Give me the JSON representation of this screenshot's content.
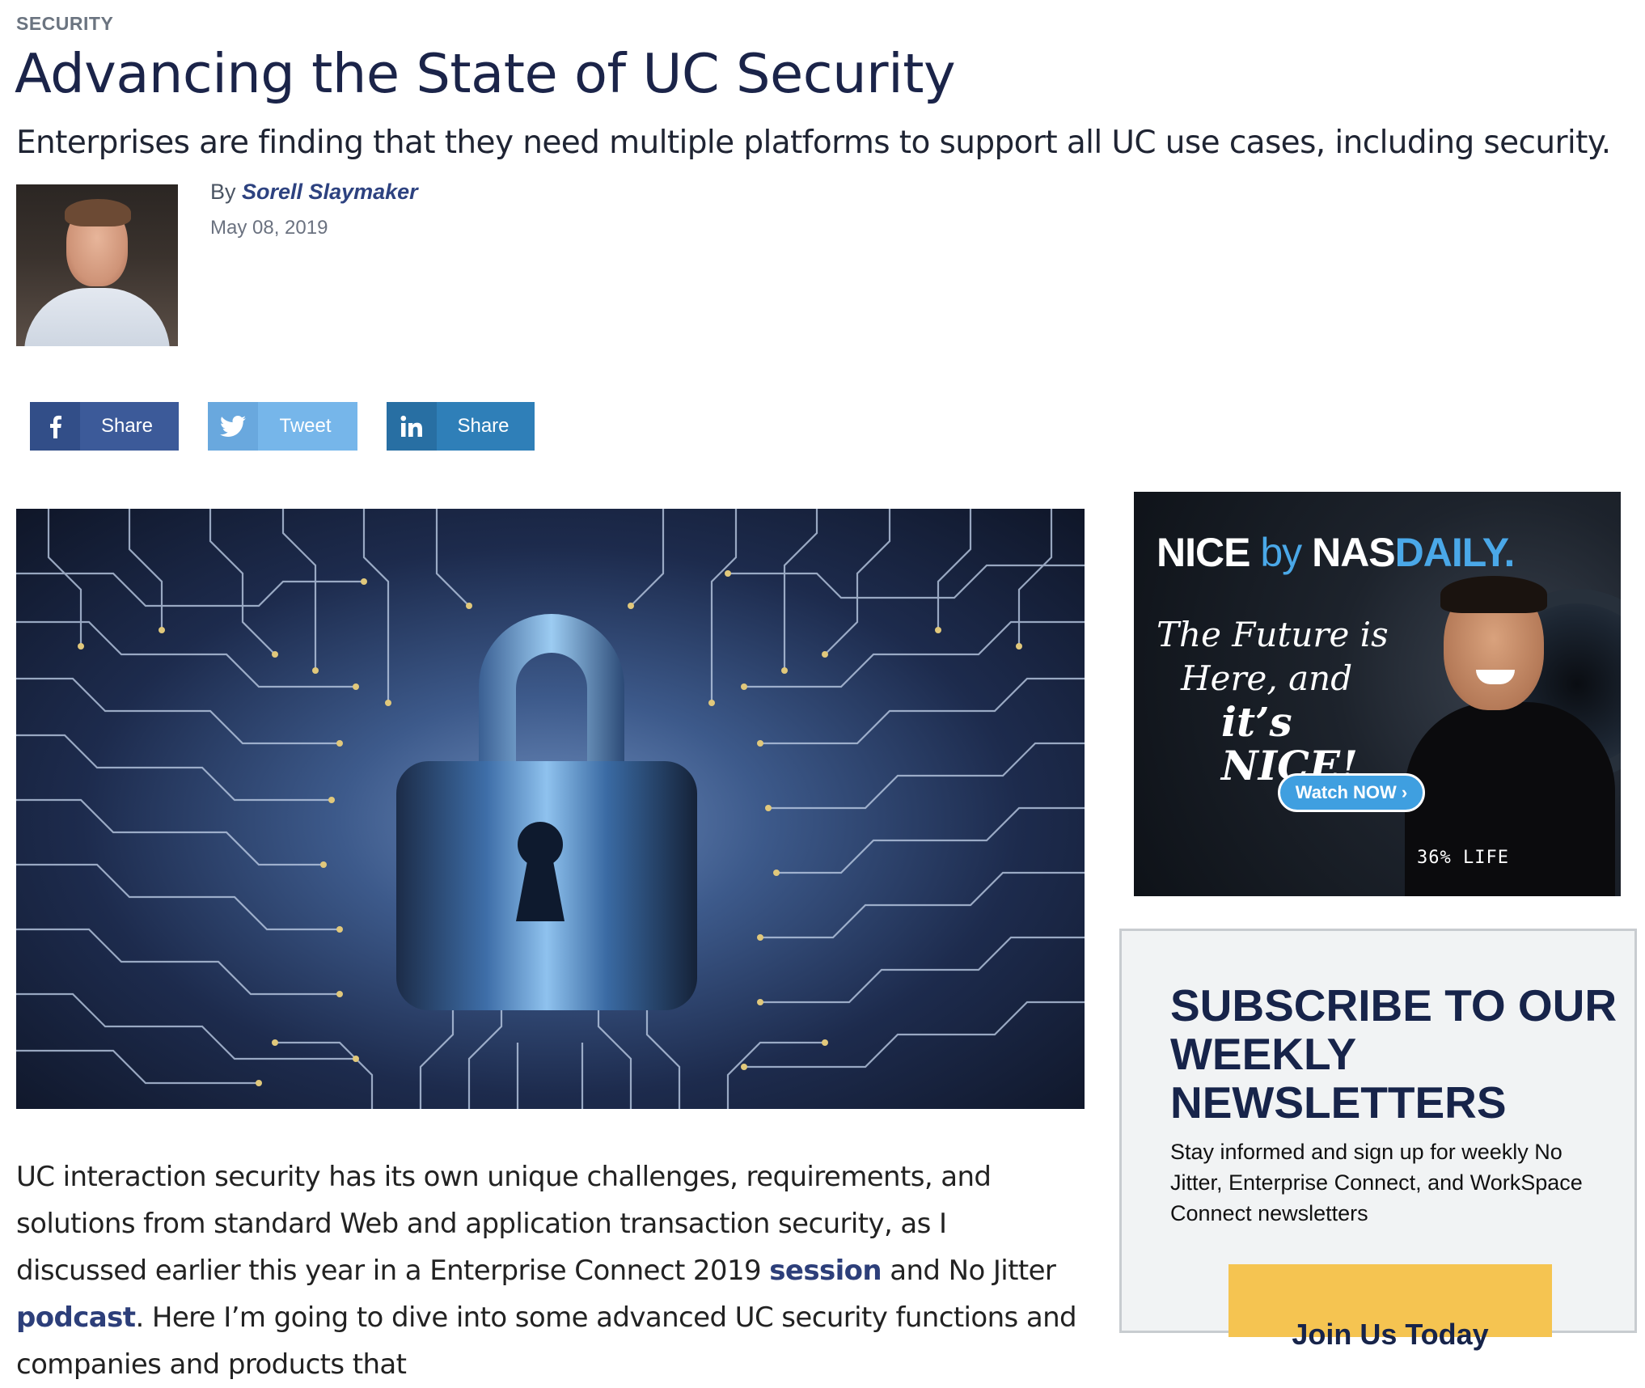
{
  "article": {
    "category": "SECURITY",
    "title": "Advancing the State of UC Security",
    "subtitle": "Enterprises are finding that they need multiple platforms to support all UC use cases, including security.",
    "byline_prefix": "By",
    "author": "Sorell Slaymaker",
    "date": "May 08, 2019",
    "body": {
      "p1_a": "UC interaction security has its own unique challenges, requirements, and solutions from standard Web and application transaction security, as I discussed earlier this year in a Enterprise Connect 2019 ",
      "link_session": "session",
      "p1_b": " and No Jitter ",
      "link_podcast": "podcast",
      "p1_c": ". Here I’m going to dive into some advanced UC security functions and companies and products that"
    }
  },
  "share": {
    "facebook_label": "Share",
    "twitter_label": "Tweet",
    "linkedin_label": "Share"
  },
  "ad": {
    "brand_nice": "NICE",
    "brand_by": "by",
    "brand_nas": "NAS",
    "brand_daily": "DAILY.",
    "tagline_1": "The Future is",
    "tagline_2": "Here, and",
    "tagline_3": "it’s NICE!",
    "cta": "Watch NOW ›",
    "shirt_text": "36%  LIFE"
  },
  "newsletter": {
    "title": "SUBSCRIBE TO OUR WEEKLY NEWSLETTERS",
    "description": "Stay informed and sign up for weekly No Jitter, Enterprise Connect, and WorkSpace Connect newsletters",
    "button": "Join Us Today"
  },
  "colors": {
    "title_navy": "#1b2449",
    "link_blue": "#2d3f7a",
    "facebook": "#3c5a99",
    "twitter": "#76b6ea",
    "linkedin": "#2f7fb8",
    "newsletter_button": "#f5c451"
  },
  "icons": {
    "facebook": "facebook-icon",
    "twitter": "twitter-icon",
    "linkedin": "linkedin-icon",
    "padlock": "padlock-icon"
  }
}
